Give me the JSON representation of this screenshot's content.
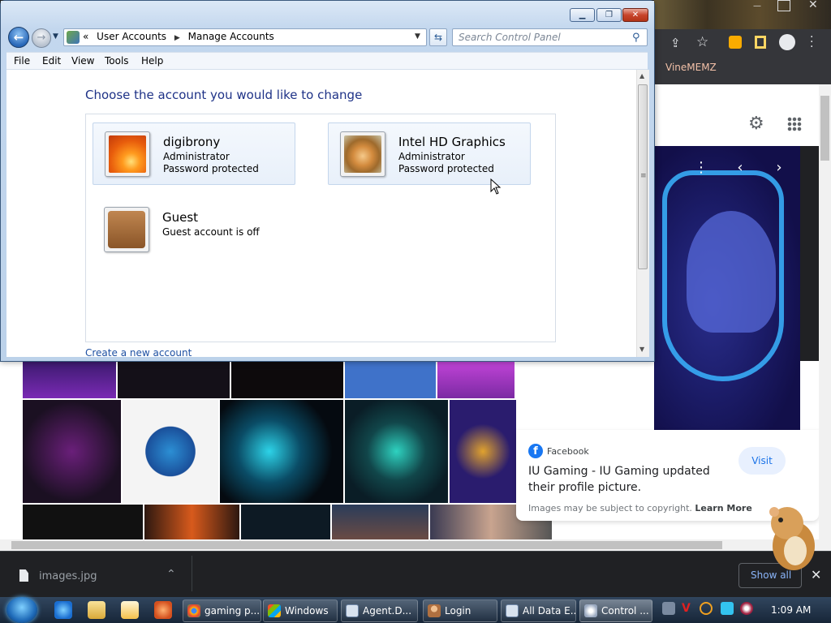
{
  "browser": {
    "bookmark": "VineMEMZ",
    "info_card": {
      "source": "Facebook",
      "title": "IU Gaming - IU Gaming updated their profile picture.",
      "visit_label": "Visit",
      "copyright": "Images may be subject to copyright.",
      "learn_more": "Learn More"
    },
    "download_bar": {
      "file_name": "images.jpg",
      "show_all_label": "Show all"
    }
  },
  "control_panel": {
    "breadcrumbs": [
      "User Accounts",
      "Manage Accounts"
    ],
    "search_placeholder": "Search Control Panel",
    "menu": [
      "File",
      "Edit",
      "View",
      "Tools",
      "Help"
    ],
    "heading": "Choose the account you would like to change",
    "accounts": [
      {
        "name": "digibrony",
        "role": "Administrator",
        "status": "Password protected",
        "picture": "flower"
      },
      {
        "name": "Intel HD Graphics",
        "role": "Administrator",
        "status": "Password protected",
        "picture": "dog"
      },
      {
        "name": "Guest",
        "role": "",
        "status": "Guest account is off",
        "picture": "briefcase"
      }
    ],
    "create_link": "Create a new account"
  },
  "taskbar": {
    "tasks": [
      {
        "label": "gaming p...",
        "icon": "chrome-icon"
      },
      {
        "label": "Windows",
        "icon": "windows-icon"
      },
      {
        "label": "Agent.D...",
        "icon": "window-icon"
      },
      {
        "label": "Login",
        "icon": "user-icon"
      },
      {
        "label": "All Data E...",
        "icon": "window-icon"
      },
      {
        "label": "Control ...",
        "icon": "control-panel-icon"
      }
    ],
    "clock": "1:09 AM"
  }
}
